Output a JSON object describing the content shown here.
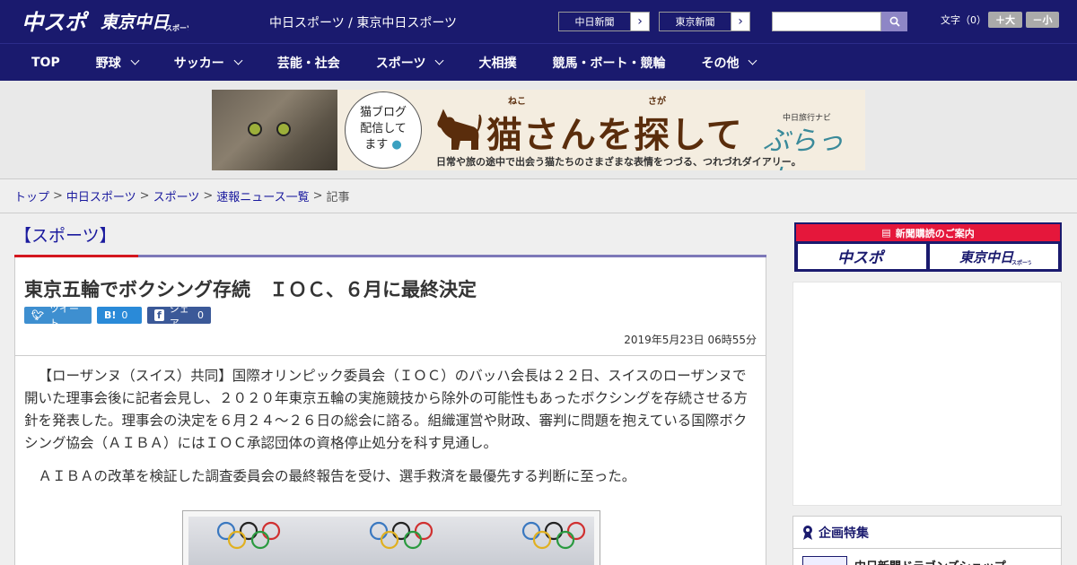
{
  "header": {
    "site_title": "中日スポーツ / 東京中日スポーツ",
    "logo_chuspo": "中スポ",
    "logo_tokyo": "東京中日スポーツ",
    "chunichi_button": "中日新聞",
    "tokyo_button": "東京新聞",
    "search_placeholder": "",
    "font_size_label": "文字（0）",
    "font_large": "＋大",
    "font_small": "－小"
  },
  "nav": {
    "items": [
      {
        "label": "TOP",
        "dropdown": false
      },
      {
        "label": "野球",
        "dropdown": true
      },
      {
        "label": "サッカー",
        "dropdown": true
      },
      {
        "label": "芸能・社会",
        "dropdown": false
      },
      {
        "label": "スポーツ",
        "dropdown": true
      },
      {
        "label": "大相撲",
        "dropdown": false
      },
      {
        "label": "競馬・ボート・競輪",
        "dropdown": false
      },
      {
        "label": "その他",
        "dropdown": true
      }
    ]
  },
  "banner": {
    "bubble_line1": "猫ブログ",
    "bubble_line2": "配信して",
    "bubble_line3": "ます",
    "ruby_neko": "ねこ",
    "ruby_saga": "さが",
    "title": "猫さんを探して",
    "subtitle": "日常や旅の途中で出会う猫たちのさまざまな表情をつづる、つれづれダイアリー。",
    "brand_small": "中日旅行ナビ",
    "brand": "ぶらっ人"
  },
  "breadcrumb": {
    "items": [
      "トップ",
      "中日スポーツ",
      "スポーツ",
      "速報ニュース一覧"
    ],
    "current": "記事"
  },
  "article": {
    "category": "【スポーツ】",
    "headline": "東京五輪でボクシング存続　ＩＯＣ、６月に最終決定",
    "share_tweet": "ツイート",
    "share_hatena_label": "B!",
    "share_hatena_count": "0",
    "share_fb_label": "シェア",
    "share_fb_count": "0",
    "pubdate": "2019年5月23日 06時55分",
    "paragraphs": [
      "【ローザンヌ（スイス）共同】国際オリンピック委員会（ＩＯＣ）のバッハ会長は２２日、スイスのローザンヌで開いた理事会後に記者会見し、２０２０年東京五輪の実施競技から除外の可能性もあったボクシングを存続させる方針を発表した。理事会の決定を６月２４～２６日の総会に諮る。組織運営や財政、審判に問題を抱えている国際ボクシング協会（ＡＩＢＡ）にはＩＯＣ承認団体の資格停止処分を科す見通し。",
      "ＡＩＢＡの改革を検証した調査委員会の最終報告を受け、選手救済を最優先する判断に至った。"
    ]
  },
  "sidebar": {
    "subscribe_head": "新聞購読のご案内",
    "logo_chuspo": "中スポ",
    "logo_tokyo": "東京中日スポーツ",
    "feature_head": "企画特集",
    "feature_item": "中日新聞ドラゴンズショップ"
  },
  "colors": {
    "navy": "#1a1a6e",
    "accent_red": "#d4161e",
    "link": "#1a1a9e"
  }
}
